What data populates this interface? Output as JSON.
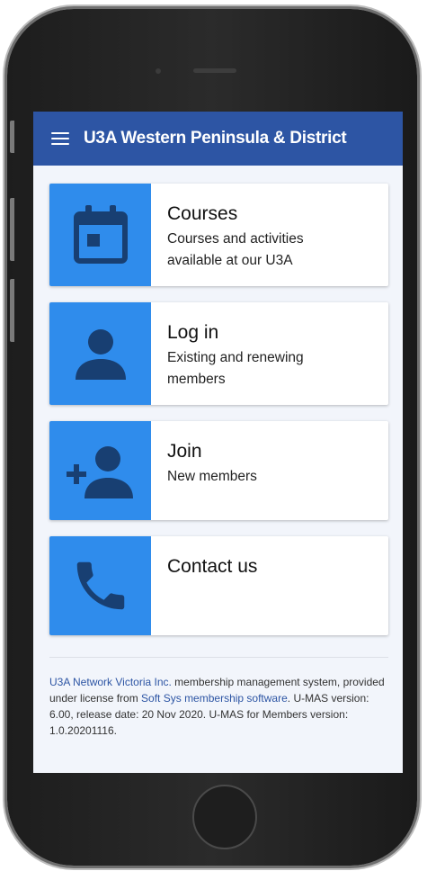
{
  "app": {
    "title": "U3A Western Peninsula & District"
  },
  "cards": [
    {
      "title": "Courses",
      "subtitle": "Courses and activities available at our U3A",
      "icon": "calendar-icon"
    },
    {
      "title": "Log in",
      "subtitle": "Existing and renewing members",
      "icon": "person-icon"
    },
    {
      "title": "Join",
      "subtitle": "New members",
      "icon": "add-person-icon"
    },
    {
      "title": "Contact us",
      "subtitle": "",
      "icon": "phone-icon"
    }
  ],
  "footer": {
    "link1": "U3A Network Victoria Inc.",
    "text1": " membership management system, provided under license from ",
    "link2": "Soft Sys membership software",
    "text2": ". U-MAS version: 6.00, release date: 20 Nov 2020. U-MAS for Members version: 1.0.20201116."
  },
  "colors": {
    "app_bar": "#2d55a4",
    "tile": "#2f8cec",
    "icon": "#183f72",
    "background": "#f2f5fb"
  }
}
